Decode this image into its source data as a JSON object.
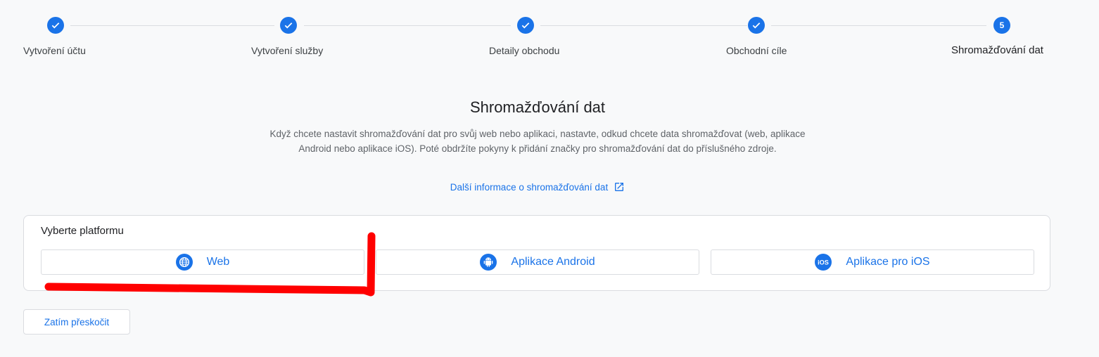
{
  "stepper": {
    "steps": [
      {
        "label": "Vytvoření účtu",
        "status": "complete"
      },
      {
        "label": "Vytvoření služby",
        "status": "complete"
      },
      {
        "label": "Detaily obchodu",
        "status": "complete"
      },
      {
        "label": "Obchodní cíle",
        "status": "complete"
      },
      {
        "label": "Shromažďování dat",
        "status": "current",
        "number": "5"
      }
    ]
  },
  "main": {
    "title": "Shromažďování dat",
    "description": "Když chcete nastavit shromažďování dat pro svůj web nebo aplikaci, nastavte, odkud chcete data shromažďovat (web, aplikace Android nebo aplikace iOS). Poté obdržíte pokyny k přidání značky pro shromažďování dat do příslušného zdroje.",
    "learn_more": "Další informace o shromažďování dat"
  },
  "platform": {
    "title": "Vyberte platformu",
    "options": [
      {
        "label": "Web",
        "icon": "globe-icon"
      },
      {
        "label": "Aplikace Android",
        "icon": "android-icon"
      },
      {
        "label": "Aplikace pro iOS",
        "icon": "ios-icon"
      }
    ]
  },
  "skip_label": "Zatím přeskočit",
  "colors": {
    "accent": "#1a73e8",
    "annotation": "#ff0000"
  }
}
